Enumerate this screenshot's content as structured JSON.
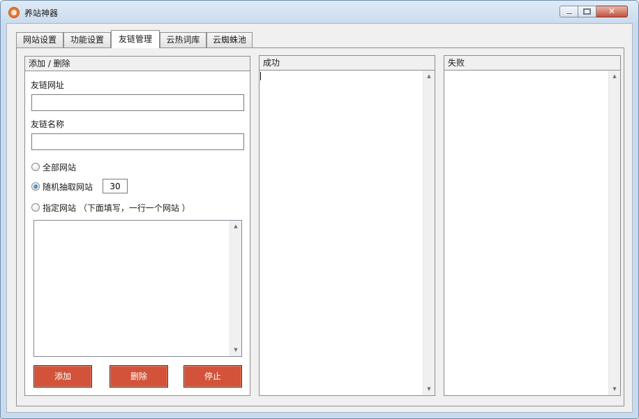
{
  "window": {
    "title": "养站神器"
  },
  "tabs": [
    {
      "label": "网站设置",
      "active": false
    },
    {
      "label": "功能设置",
      "active": false
    },
    {
      "label": "友链管理",
      "active": true
    },
    {
      "label": "云热词库",
      "active": false
    },
    {
      "label": "云蜘蛛池",
      "active": false
    }
  ],
  "left_panel": {
    "header": "添加 / 删除",
    "url_label": "友链网址",
    "url_value": "",
    "name_label": "友链名称",
    "name_value": "",
    "radio_all": "全部网站",
    "radio_random": "随机抽取网站",
    "random_count": "30",
    "radio_specified": "指定网站 （下面填写，一行一个网站 ）",
    "selected_option": "radio_random",
    "sites_text": "",
    "buttons": {
      "add": "添加",
      "delete": "删除",
      "stop": "停止"
    }
  },
  "success_panel": {
    "header": "成功"
  },
  "fail_panel": {
    "header": "失败"
  },
  "colors": {
    "button_red": "#d2533a",
    "title_bar": "#cbdcee",
    "accent_icon": "#e9742f"
  }
}
